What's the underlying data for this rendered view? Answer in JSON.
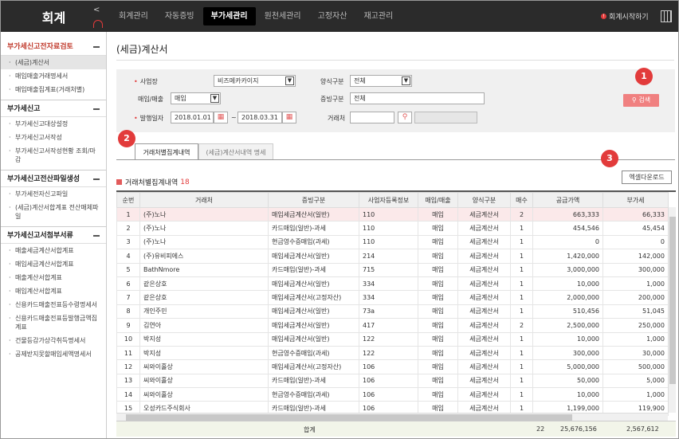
{
  "app_title": "회계",
  "nav": [
    "회계관리",
    "자동증빙",
    "부가세관리",
    "원천세관리",
    "고정자산",
    "재고관리"
  ],
  "nav_active": "부가세관리",
  "start_help": "회계시작하기",
  "sidebar": [
    {
      "title": "부가세신고전자료검토",
      "items": [
        "(세금)계산서",
        "매입매출거래명세서",
        "매입매출집계표(거래처별)"
      ]
    },
    {
      "title": "부가세신고",
      "items": [
        "부가세신고대상설정",
        "부가세신고서작성",
        "부가세신고서작성현황 조회/마감"
      ]
    },
    {
      "title": "부가세신고전산파일생성",
      "items": [
        "부가세전자신고파일",
        "(세금)계산서합계표 전산매체파일"
      ]
    },
    {
      "title": "부가세신고서첨부서류",
      "items": [
        "매출세금계산서합계표",
        "매입세금계산서합계표",
        "매출계산서합계표",
        "매입계산서합계표",
        "신용카드매출전표등수령명세서",
        "신용카드매출전표등발행금액집계표",
        "건물등감가상각취득명세서",
        "공제받지못할매입세액명세서"
      ]
    }
  ],
  "page_title": "(세금)계산서",
  "filters": {
    "business_label": "사업장",
    "business_value": "비즈메카카이지",
    "trade_type_label": "매입/매출",
    "trade_type_value": "매입",
    "issue_date_label": "발행일자",
    "date_from": "2018.01.01",
    "date_sep": "~",
    "date_to": "2018.03.31",
    "form_type_label": "양식구분",
    "form_type_value": "전체",
    "evidence_label": "증빙구분",
    "evidence_value": "전체",
    "partner_label": "거래처",
    "partner_value": "",
    "search_label": "검색"
  },
  "badges": [
    "1",
    "2",
    "3"
  ],
  "tabs": [
    "거래처별집계내역",
    "(세금)계산서내역 명세"
  ],
  "export_label": "엑셀다운로드",
  "list_title": "거래처별집계내역",
  "list_count": "18",
  "table": {
    "headers": [
      "순번",
      "거래처",
      "증빙구분",
      "사업자등록정보",
      "매입/매출",
      "양식구분",
      "매수",
      "공급가액",
      "부가세"
    ],
    "rows": [
      [
        "1",
        "(주)노나",
        "매입세금계산서(일반)",
        "110",
        "매입",
        "세금계산서",
        "2",
        "663,333",
        "66,333"
      ],
      [
        "2",
        "(주)노나",
        "카드매입(일반)-과세",
        "110",
        "매입",
        "세금계산서",
        "1",
        "454,546",
        "45,454"
      ],
      [
        "3",
        "(주)노나",
        "현금영수증매입(과세)",
        "110",
        "매입",
        "세금계산서",
        "1",
        "0",
        "0"
      ],
      [
        "4",
        "(주)유비피에스",
        "매입세금계산서(일반)",
        "214",
        "매입",
        "세금계산서",
        "1",
        "1,420,000",
        "142,000"
      ],
      [
        "5",
        "BathNmore",
        "카드매입(일반)-과세",
        "715",
        "매입",
        "세금계산서",
        "1",
        "3,000,000",
        "300,000"
      ],
      [
        "6",
        "같은상호",
        "매입세금계산서(일반)",
        "334",
        "매입",
        "세금계산서",
        "1",
        "10,000",
        "1,000"
      ],
      [
        "7",
        "같은상호",
        "매입세금계산서(고정자산)",
        "334",
        "매입",
        "세금계산서",
        "1",
        "2,000,000",
        "200,000"
      ],
      [
        "8",
        "개인주민",
        "매입세금계산서(일반)",
        "73a",
        "매입",
        "세금계산서",
        "1",
        "510,456",
        "51,045"
      ],
      [
        "9",
        "김연아",
        "매입세금계산서(일반)",
        "417",
        "매입",
        "세금계산서",
        "2",
        "2,500,000",
        "250,000"
      ],
      [
        "10",
        "박지성",
        "매입세금계산서(일반)",
        "122",
        "매입",
        "세금계산서",
        "1",
        "10,000",
        "1,000"
      ],
      [
        "11",
        "박지성",
        "현금영수증매입(과세)",
        "122",
        "매입",
        "세금계산서",
        "1",
        "300,000",
        "30,000"
      ],
      [
        "12",
        "씨와이홀상",
        "매입세금계산서(고정자산)",
        "106",
        "매입",
        "세금계산서",
        "1",
        "5,000,000",
        "500,000"
      ],
      [
        "13",
        "씨와이홀상",
        "카드매입(일반)-과세",
        "106",
        "매입",
        "세금계산서",
        "1",
        "50,000",
        "5,000"
      ],
      [
        "14",
        "씨와이홀상",
        "현금영수증매입(과세)",
        "106",
        "매입",
        "세금계산서",
        "1",
        "10,000",
        "1,000"
      ],
      [
        "15",
        "오성카드주식회사",
        "카드매입(일반)-과세",
        "106",
        "매입",
        "세금계산서",
        "1",
        "1,199,000",
        "119,900"
      ]
    ],
    "total_label": "합계",
    "total_count": "22",
    "total_supply": "25,676,156",
    "total_vat": "2,567,612"
  }
}
